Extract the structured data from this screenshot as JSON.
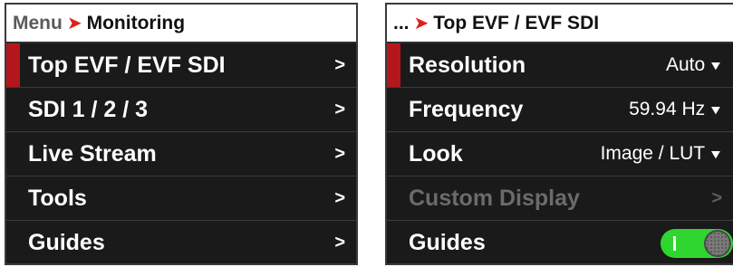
{
  "left_panel": {
    "breadcrumb_parent": "Menu",
    "breadcrumb_current": "Monitoring",
    "items": [
      {
        "label": "Top EVF / EVF SDI"
      },
      {
        "label": "SDI 1 / 2 / 3"
      },
      {
        "label": "Live Stream"
      },
      {
        "label": "Tools"
      },
      {
        "label": "Guides"
      }
    ]
  },
  "right_panel": {
    "breadcrumb_parent": "...",
    "breadcrumb_current": "Top EVF / EVF SDI",
    "resolution": {
      "label": "Resolution",
      "value": "Auto"
    },
    "frequency": {
      "label": "Frequency",
      "value": "59.94 Hz"
    },
    "look": {
      "label": "Look",
      "value": "Image / LUT"
    },
    "custom_display": {
      "label": "Custom Display",
      "enabled": false
    },
    "guides": {
      "label": "Guides",
      "on": true
    }
  },
  "icons": {
    "breadcrumb_separator": "chevron-right-red",
    "submenu": "chevron-right",
    "dropdown": "caret-down",
    "toggle": "toggle-switch"
  },
  "colors": {
    "selection_marker": "#b3171c",
    "breadcrumb_separator": "#e0201a",
    "toggle_on": "#2fd62f",
    "row_background": "#1a1a1a",
    "disabled_text": "#6b6b6b"
  }
}
